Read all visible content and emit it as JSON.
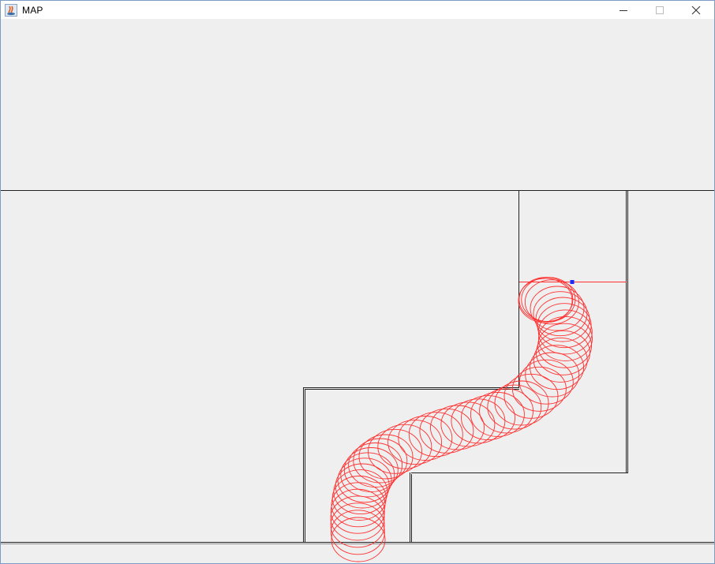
{
  "window": {
    "title": "MAP",
    "icon": "java-app-icon",
    "controls": {
      "minimize": "minimize-icon",
      "maximize": "maximize-icon",
      "close": "close-icon"
    }
  },
  "colors": {
    "path": "#ff3030",
    "walls": "#222222",
    "marker": "#1a2bff",
    "background": "#efefef"
  }
}
